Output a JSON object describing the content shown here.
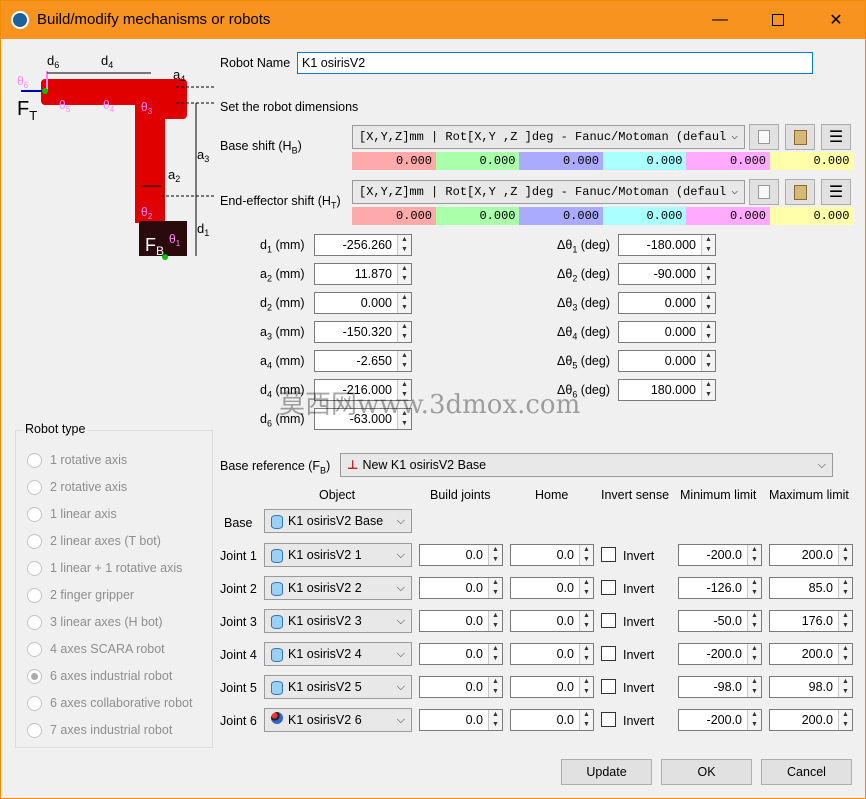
{
  "window": {
    "title": "Build/modify mechanisms or robots"
  },
  "robot_name": {
    "label": "Robot Name",
    "value": "K1 osirisV2"
  },
  "dimensions_heading": "Set the robot dimensions",
  "base_shift": {
    "label": "Base shift (H",
    "sub": "B",
    "close": ")",
    "format": "[X,Y,Z]mm | Rot[X,Y ,Z  ]deg - Fanuc/Motoman (defaul",
    "values": [
      "0.000",
      "0.000",
      "0.000",
      "0.000",
      "0.000",
      "0.000"
    ]
  },
  "ee_shift": {
    "label": "End-effector shift (H",
    "sub": "T",
    "close": ")",
    "format": "[X,Y,Z]mm | Rot[X,Y ,Z  ]deg - Fanuc/Motoman (defaul",
    "values": [
      "0.000",
      "0.000",
      "0.000",
      "0.000",
      "0.000",
      "0.000"
    ]
  },
  "cell_colors": [
    "#ffaaaa",
    "#aaffaa",
    "#aaaaff",
    "#aaffff",
    "#ffaaff",
    "#ffffaa"
  ],
  "params_left": [
    {
      "l": "d",
      "s": "1",
      "u": " (mm)",
      "v": "-256.260"
    },
    {
      "l": "a",
      "s": "2",
      "u": " (mm)",
      "v": "11.870"
    },
    {
      "l": "d",
      "s": "2",
      "u": " (mm)",
      "v": "0.000"
    },
    {
      "l": "a",
      "s": "3",
      "u": " (mm)",
      "v": "-150.320"
    },
    {
      "l": "a",
      "s": "4",
      "u": " (mm)",
      "v": "-2.650"
    },
    {
      "l": "d",
      "s": "4",
      "u": " (mm)",
      "v": "-216.000"
    },
    {
      "l": "d",
      "s": "6",
      "u": " (mm)",
      "v": "-63.000"
    }
  ],
  "params_right": [
    {
      "l": "Δθ",
      "s": "1",
      "u": " (deg)",
      "v": "-180.000"
    },
    {
      "l": "Δθ",
      "s": "2",
      "u": " (deg)",
      "v": "-90.000"
    },
    {
      "l": "Δθ",
      "s": "3",
      "u": " (deg)",
      "v": "0.000"
    },
    {
      "l": "Δθ",
      "s": "4",
      "u": " (deg)",
      "v": "0.000"
    },
    {
      "l": "Δθ",
      "s": "5",
      "u": " (deg)",
      "v": "0.000"
    },
    {
      "l": "Δθ",
      "s": "6",
      "u": " (deg)",
      "v": "180.000"
    }
  ],
  "watermark": "莫西网www.3dmox.com",
  "robot_type": {
    "title": "Robot type",
    "options": [
      "1 rotative axis",
      "2 rotative axis",
      "1 linear axis",
      "2 linear axes (T bot)",
      "1 linear + 1 rotative axis",
      "2 finger gripper",
      "3 linear axes (H bot)",
      "4 axes SCARA robot",
      "6 axes industrial robot",
      "6 axes collaborative robot",
      "7 axes industrial robot"
    ],
    "selected": "6 axes industrial robot"
  },
  "base_reference": {
    "label": "Base reference (F",
    "sub": "B",
    "close": ")",
    "value": "New K1 osirisV2 Base"
  },
  "headers": {
    "object": "Object",
    "build": "Build joints",
    "home": "Home",
    "invert": "Invert sense",
    "min": "Minimum limit",
    "max": "Maximum limit"
  },
  "base_row": {
    "label": "Base",
    "object": "K1 osirisV2 Base"
  },
  "joints": [
    {
      "label": "Joint 1",
      "object": "K1 osirisV2 1",
      "build": "0.0",
      "home": "0.0",
      "invert": "Invert",
      "min": "-200.0",
      "max": "200.0"
    },
    {
      "label": "Joint 2",
      "object": "K1 osirisV2 2",
      "build": "0.0",
      "home": "0.0",
      "invert": "Invert",
      "min": "-126.0",
      "max": "85.0"
    },
    {
      "label": "Joint 3",
      "object": "K1 osirisV2 3",
      "build": "0.0",
      "home": "0.0",
      "invert": "Invert",
      "min": "-50.0",
      "max": "176.0"
    },
    {
      "label": "Joint 4",
      "object": "K1 osirisV2 4",
      "build": "0.0",
      "home": "0.0",
      "invert": "Invert",
      "min": "-200.0",
      "max": "200.0"
    },
    {
      "label": "Joint 5",
      "object": "K1 osirisV2 5",
      "build": "0.0",
      "home": "0.0",
      "invert": "Invert",
      "min": "-98.0",
      "max": "98.0"
    },
    {
      "label": "Joint 6",
      "object": "K1 osirisV2 6",
      "build": "0.0",
      "home": "0.0",
      "invert": "Invert",
      "min": "-200.0",
      "max": "200.0"
    }
  ],
  "buttons": {
    "update": "Update",
    "ok": "OK",
    "cancel": "Cancel"
  },
  "diagram": {
    "d6": "d",
    "d6s": "6",
    "d4": "d",
    "d4s": "4",
    "a4": "a",
    "a4s": "4",
    "a3": "a",
    "a3s": "3",
    "a2": "a",
    "a2s": "2",
    "d1": "d",
    "d1s": "1",
    "ft": "F",
    "fts": "T",
    "fb": "F",
    "fbs": "B",
    "t1": "θ",
    "t1s": "1",
    "t2": "θ",
    "t2s": "2",
    "t3": "θ",
    "t3s": "3",
    "t4": "θ",
    "t4s": "4",
    "t5": "θ",
    "t5s": "5",
    "t6": "θ",
    "t6s": "6"
  }
}
